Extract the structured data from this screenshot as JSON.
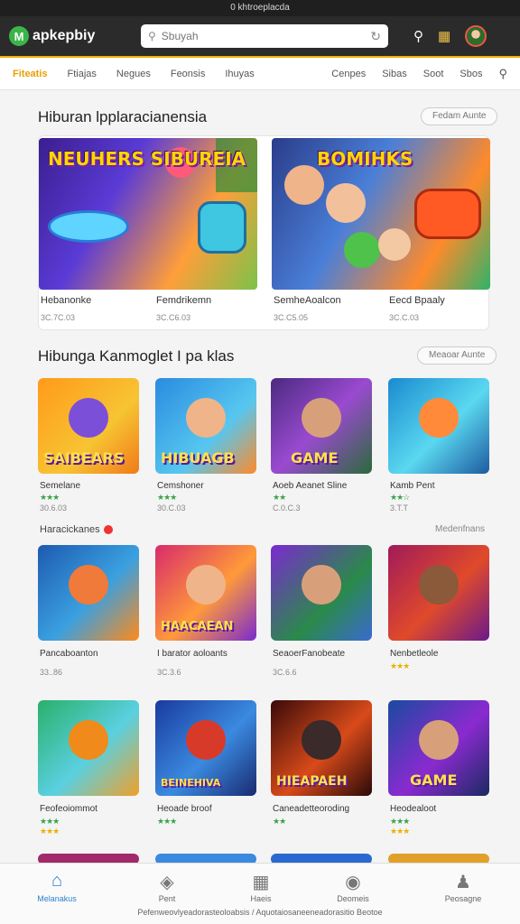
{
  "status_bar": {
    "text": "0 khtroeplacda"
  },
  "header": {
    "app_name": "apkepbiy",
    "logo_letter": "M",
    "search_placeholder": "Sbuyah",
    "icons": [
      "search-icon",
      "calendar-icon",
      "avatar"
    ]
  },
  "nav": {
    "items": [
      "Fiteatis",
      "Ftiajas",
      "Negues",
      "Feonsis",
      "Ihuyas"
    ],
    "right_items": [
      "Cenpes",
      "Sibas",
      "Soot",
      "Sbos"
    ],
    "accent": "#e8a000"
  },
  "section1": {
    "title": "Hiburan  lpplaracianensia",
    "see_all": "Fedam Aunte",
    "banners": [
      {
        "title": "NEUHERS SIBUREIA",
        "label_a": "Hebanonke",
        "sub_a": "3C.7C.03",
        "label_b": "Femdrikemn",
        "sub_b": "3C.C6.03"
      },
      {
        "title": "BOMIHKS",
        "label_a": "SemheAoalcon",
        "sub_a": "3C.C5.05",
        "label_b": "Eecd Bpaaly",
        "sub_b": "3C.C.03"
      }
    ]
  },
  "section2": {
    "title": "Hibunga Kanmoglet I pa klas",
    "see_all": "Meaoar Aunte",
    "games": [
      {
        "tile_text": "SAIBEARS",
        "label": "Semelane",
        "stars": "★★★",
        "meta": "30.6.03"
      },
      {
        "tile_text": "HIBUAGB",
        "label": "Cemshoner",
        "stars": "★★★",
        "meta": "30.C.03"
      },
      {
        "tile_text": "GAME",
        "label": "Aoeb Aeanet Sline",
        "stars": "★★",
        "meta": "C.0.C.3"
      },
      {
        "tile_text": "",
        "label": "Kamb Pent",
        "stars": "★★☆",
        "meta": "3.T.T"
      }
    ]
  },
  "section3": {
    "title": "Haracickanes",
    "right_link": "Medenfnans",
    "games": [
      {
        "tile_text": "",
        "label": "Pancaboanton",
        "stars": "",
        "meta": "33..86"
      },
      {
        "tile_text": "HAACAEAN",
        "label": "I barator aoloants",
        "stars": "",
        "meta": "3C.3.6"
      },
      {
        "tile_text": "",
        "label": "SeaoerFanobeate",
        "stars": "",
        "meta": "3C.6.6"
      },
      {
        "tile_text": "",
        "label": "Nenbetleole",
        "stars": "★★★",
        "meta": ""
      }
    ]
  },
  "section4": {
    "games": [
      {
        "tile_text": "",
        "label": "Feofeoiommot",
        "stars": "★★★",
        "meta": "★★★"
      },
      {
        "tile_text": "BEINEHIVA",
        "label": "Heoade broof",
        "stars": "★★★",
        "meta": ""
      },
      {
        "tile_text": "HIEAPAEH",
        "label": "Caneadetteoroding",
        "stars": "★★",
        "meta": ""
      },
      {
        "tile_text": "GAME",
        "label": "Heodealoot",
        "stars": "★★★",
        "meta": "★★★"
      }
    ]
  },
  "bottom_nav": {
    "items": [
      {
        "label": "Melanakus",
        "icon": "home-icon"
      },
      {
        "label": "Pent",
        "icon": "tag-icon"
      },
      {
        "label": "Haeis",
        "icon": "book-icon"
      },
      {
        "label": "Deomeis",
        "icon": "camera-icon"
      },
      {
        "label": "Peosagne",
        "icon": "person-icon"
      }
    ],
    "active_color": "#2f7fd0"
  },
  "footer": {
    "text": "Pefenweovlyeadorasteoloabsis / Aquotaiosaneeneadorasitio Beotoe"
  }
}
